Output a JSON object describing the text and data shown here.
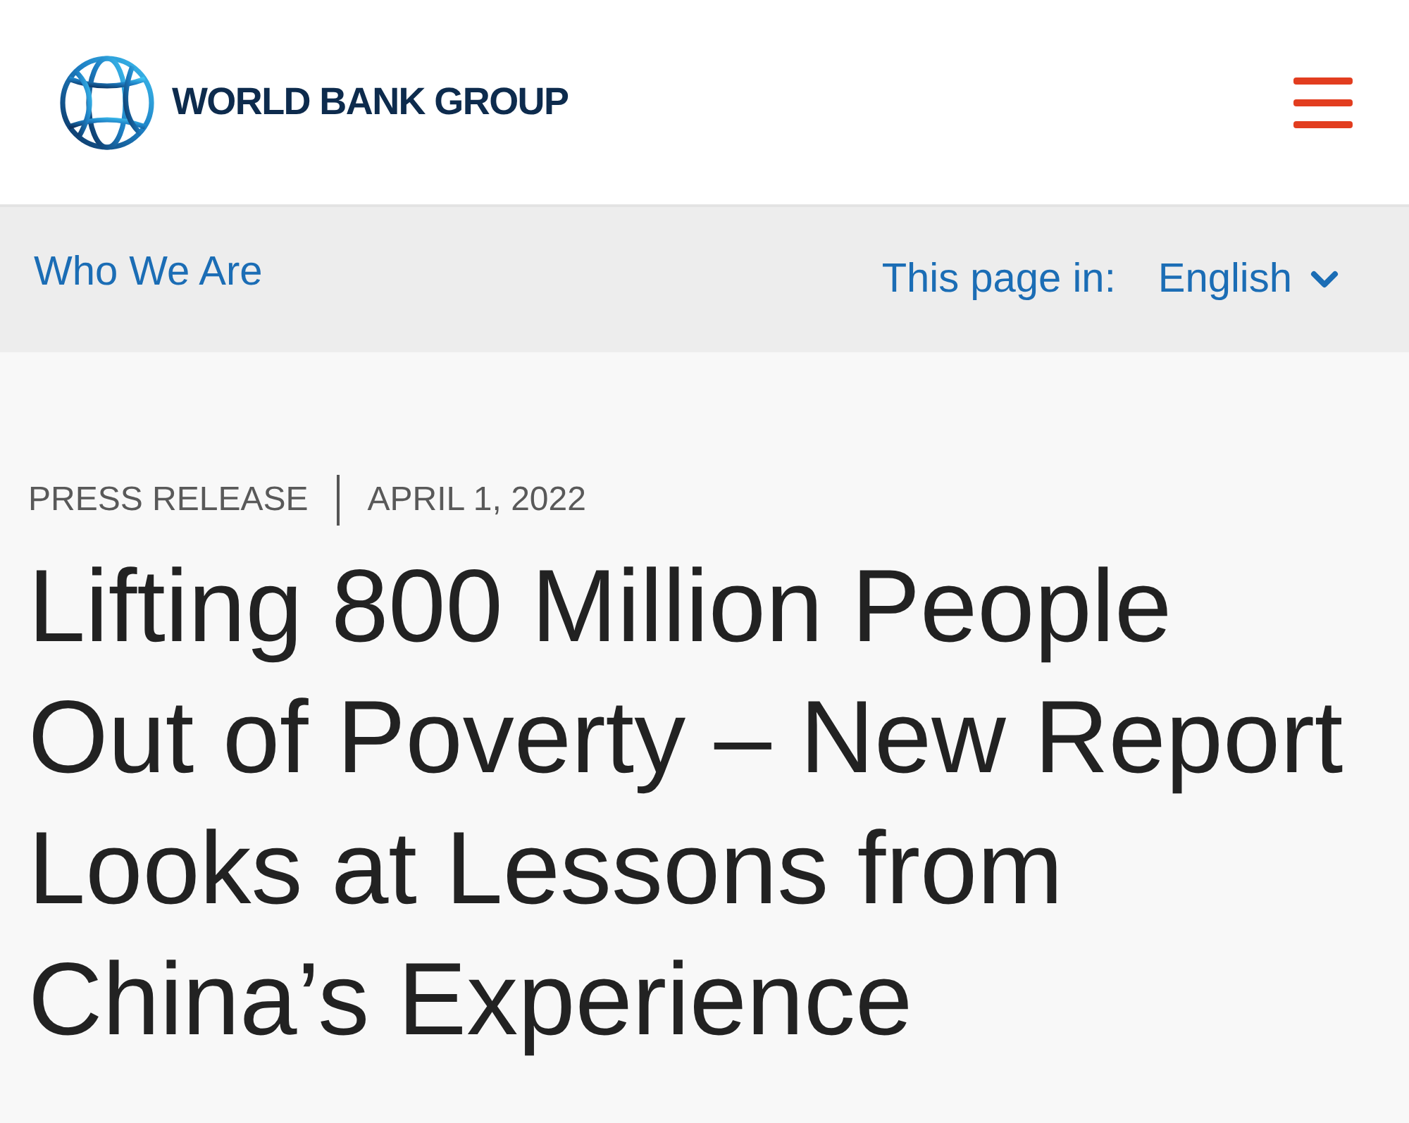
{
  "header": {
    "logo_text": "WORLD BANK GROUP"
  },
  "subnav": {
    "section_link": "Who We Are",
    "language_label": "This page in:",
    "language": "English"
  },
  "article": {
    "type": "PRESS RELEASE",
    "date": "APRIL 1, 2022",
    "title": "Lifting 800 Million People Out of Poverty – New Report Looks at Lessons from China’s Experience"
  }
}
